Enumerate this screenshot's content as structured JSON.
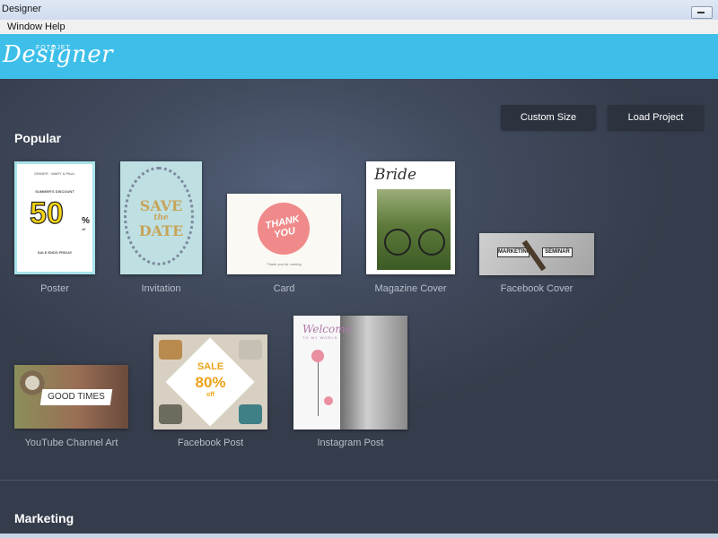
{
  "window": {
    "title": "Designer",
    "menu": [
      "Window",
      "Help"
    ]
  },
  "header": {
    "logo_top": "FOTOJET",
    "logo_main": "Designer",
    "accent_color": "#3ebfea"
  },
  "actions": {
    "custom_size": "Custom Size",
    "load_project": "Load Project"
  },
  "sections": {
    "popular": "Popular",
    "marketing": "Marketing"
  },
  "templates": [
    {
      "label": "Poster"
    },
    {
      "label": "Invitation"
    },
    {
      "label": "Card"
    },
    {
      "label": "Magazine Cover"
    },
    {
      "label": "Facebook Cover"
    },
    {
      "label": "YouTube Channel Art"
    },
    {
      "label": "Facebook Post"
    },
    {
      "label": "Instagram Post"
    }
  ],
  "thumbs": {
    "poster": {
      "big": "50",
      "pct": "%",
      "off": "off",
      "line1": "SUMMER'S DISCOUNT",
      "line2": "SALE ENDS FRIDAY"
    },
    "invitation": {
      "l1": "SAVE",
      "l2": "the",
      "l3": "DATE"
    },
    "card": {
      "text": "THANK YOU"
    },
    "magazine": {
      "title": "Bride"
    },
    "facebook_cover": {
      "left": "MARKETING",
      "right": "SEMINAR"
    },
    "youtube": {
      "text": "GOOD TIMES"
    },
    "facebook_post": {
      "sale": "SALE",
      "pct": "80%",
      "off": "off"
    },
    "instagram": {
      "welcome": "Welcome",
      "sub": "TO MY WORLD"
    }
  }
}
